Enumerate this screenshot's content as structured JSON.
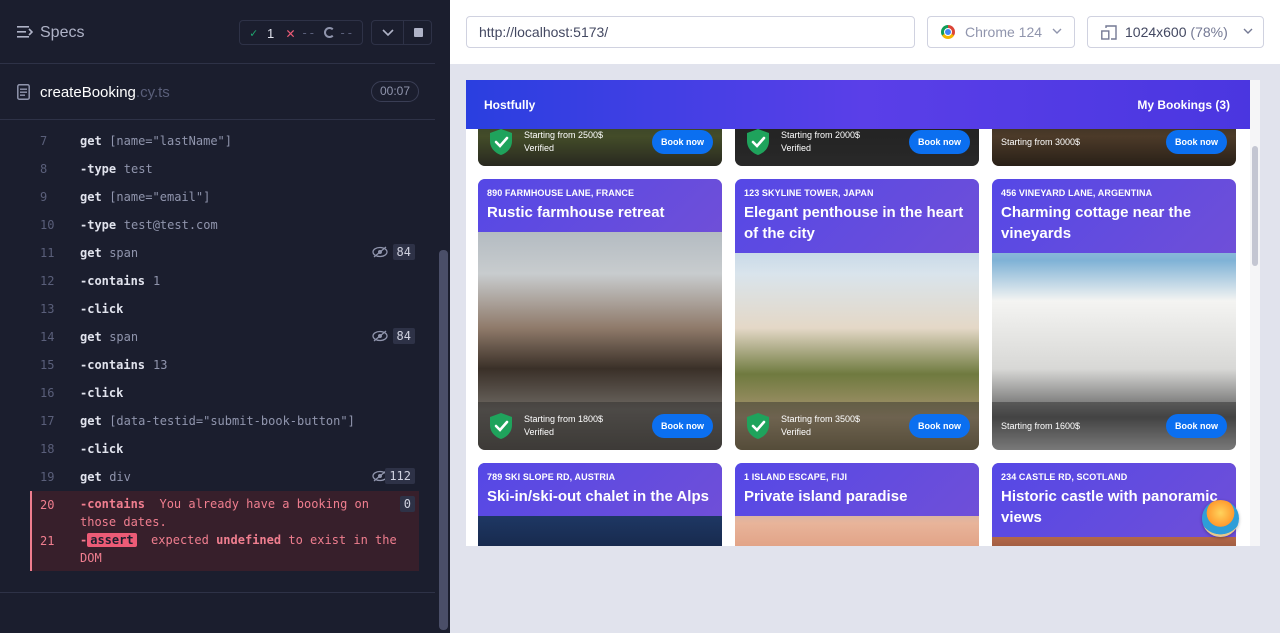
{
  "sidebar": {
    "title": "Specs",
    "stats": {
      "passed": "1",
      "failed": "--",
      "pending": "--"
    },
    "file": {
      "name": "createBooking",
      "ext": ".cy.ts",
      "duration": "00:07"
    }
  },
  "commands": [
    {
      "num": "7",
      "name": "get",
      "msg": "[name=\"lastName\"]"
    },
    {
      "num": "8",
      "name": "-type",
      "msg": "test"
    },
    {
      "num": "9",
      "name": "get",
      "msg": "[name=\"email\"]"
    },
    {
      "num": "10",
      "name": "-type",
      "msg": "test@test.com"
    },
    {
      "num": "11",
      "name": "get",
      "msg": "span",
      "count": "84"
    },
    {
      "num": "12",
      "name": "-contains",
      "msg": "1"
    },
    {
      "num": "13",
      "name": "-click",
      "msg": ""
    },
    {
      "num": "14",
      "name": "get",
      "msg": "span",
      "count": "84"
    },
    {
      "num": "15",
      "name": "-contains",
      "msg": "13"
    },
    {
      "num": "16",
      "name": "-click",
      "msg": ""
    },
    {
      "num": "17",
      "name": "get",
      "msg": "[data-testid=\"submit-book-button\"]"
    },
    {
      "num": "18",
      "name": "-click",
      "msg": ""
    },
    {
      "num": "19",
      "name": "get",
      "msg": "div",
      "count": "112"
    }
  ],
  "error_commands": [
    {
      "num": "20",
      "name": "-contains",
      "msg": "You already have a booking on those dates.",
      "count": "0"
    },
    {
      "num": "21",
      "name": "-",
      "badge": "assert",
      "msg_a": "expected",
      "msg_b": "undefined",
      "msg_c": "to exist in the DOM"
    }
  ],
  "aut": {
    "url": "http://localhost:5173/",
    "browser": "Chrome 124",
    "viewport": "1024x600",
    "scale": "(78%)"
  },
  "app": {
    "logo": "Hostfully",
    "my_bookings": "My Bookings (3)",
    "top_cards": [
      {
        "price": "Starting from 2500$",
        "verified": "Verified",
        "book": "Book now"
      },
      {
        "price": "Starting from 2000$",
        "verified": "Verified",
        "book": "Book now"
      },
      {
        "price": "Starting from 3000$",
        "verified": "",
        "book": "Book now"
      }
    ],
    "cards": [
      {
        "address": "890 Farmhouse Lane, France",
        "title": "Rustic farmhouse retreat",
        "price": "Starting from 1800$",
        "verified": "Verified",
        "book": "Book now"
      },
      {
        "address": "123 Skyline Tower, Japan",
        "title": "Elegant penthouse in the heart of the city",
        "price": "Starting from 3500$",
        "verified": "Verified",
        "book": "Book now"
      },
      {
        "address": "456 Vineyard Lane, Argentina",
        "title": "Charming cottage near the vineyards",
        "price": "Starting from 1600$",
        "verified": "",
        "book": "Book now"
      },
      {
        "address": "789 Ski Slope Rd, Austria",
        "title": "Ski-in/ski-out chalet in the Alps"
      },
      {
        "address": "1 Island Escape, Fiji",
        "title": "Private island paradise"
      },
      {
        "address": "234 Castle Rd, Scotland",
        "title": "Historic castle with panoramic views"
      }
    ]
  },
  "colors": {
    "pass": "#1fa971",
    "fail": "#ec5b76",
    "primary": "#0b6ff0",
    "header": "#4a36e0"
  }
}
